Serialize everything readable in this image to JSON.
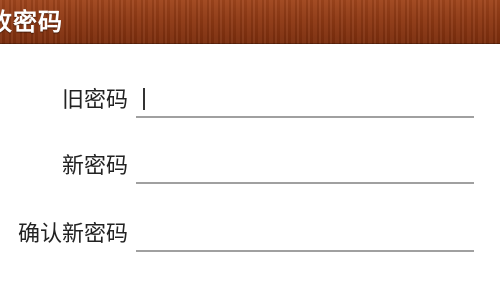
{
  "header": {
    "title": "改密码"
  },
  "form": {
    "old_password": {
      "label": "旧密码",
      "value": ""
    },
    "new_password": {
      "label": "新密码",
      "value": ""
    },
    "confirm_password": {
      "label": "确认新密码",
      "value": ""
    }
  },
  "colors": {
    "header_bg": "#8e3914",
    "underline": "#a0a0a0"
  }
}
